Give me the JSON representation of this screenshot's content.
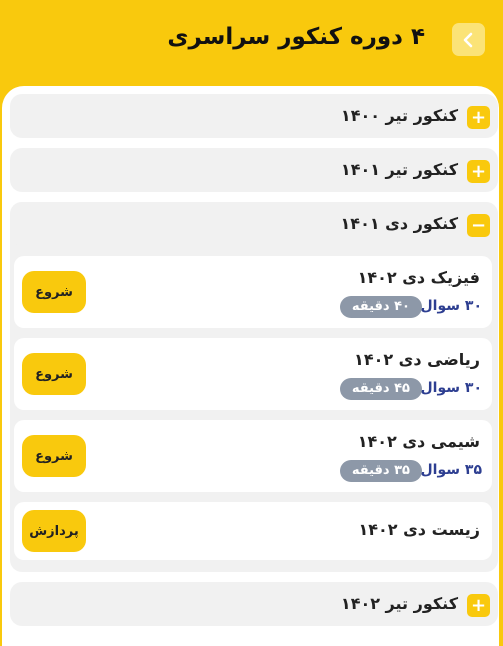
{
  "header": {
    "title": "۴ دوره کنکور سراسری",
    "back_icon": "chevron-left-icon"
  },
  "accordions": [
    {
      "label": "کنکور تیر ۱۴۰۰",
      "icon": "+"
    },
    {
      "label": "کنکور تیر ۱۴۰۱",
      "icon": "+"
    },
    {
      "label": "کنکور دی ۱۴۰۱",
      "icon": "−"
    },
    {
      "label": "کنکور تیر ۱۴۰۲",
      "icon": "+"
    }
  ],
  "exams": [
    {
      "name": "فیزیک دی ۱۴۰۲",
      "questions": "۳۰ سوال",
      "duration": "۴۰ دقیقه",
      "action": "شروع"
    },
    {
      "name": "ریاضی دی ۱۴۰۲",
      "questions": "۳۰ سوال",
      "duration": "۴۵ دقیقه",
      "action": "شروع"
    },
    {
      "name": "شیمی دی ۱۴۰۲",
      "questions": "۳۵ سوال",
      "duration": "۳۵ دقیقه",
      "action": "شروع"
    },
    {
      "name": "زیست دی ۱۴۰۲",
      "action": "پردازش"
    }
  ],
  "colors": {
    "accent": "#f9c90d",
    "pill": "#8d98a8",
    "questions": "#2d3e91"
  }
}
